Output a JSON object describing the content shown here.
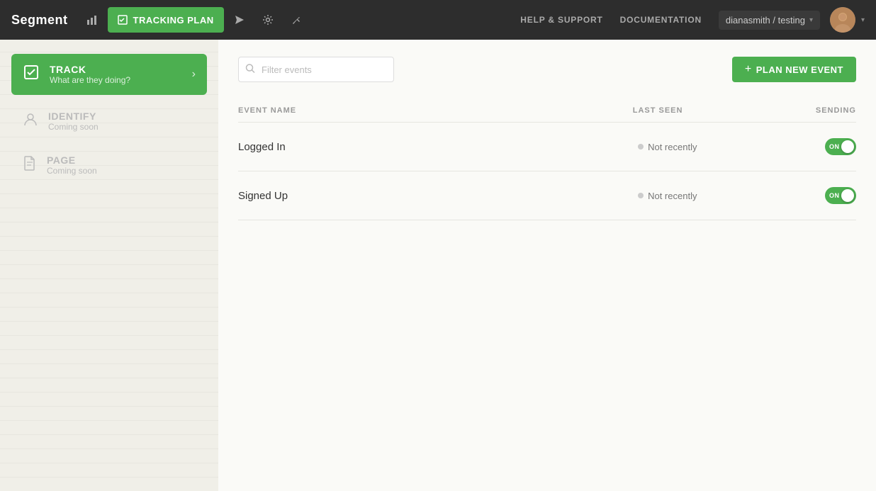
{
  "brand": "Segment",
  "topnav": {
    "active_section": "TRACKING PLAN",
    "links": [
      "HELP & SUPPORT",
      "DOCUMENTATION"
    ],
    "workspace": "dianasmith / testing",
    "icons": {
      "chart": "📊",
      "tracking": "📋",
      "bars": "▐",
      "send": "◀",
      "gear": "⚙",
      "tool": "⚒"
    }
  },
  "sidebar": {
    "items": [
      {
        "id": "track",
        "title": "TRACK",
        "subtitle": "What are they doing?",
        "active": true
      },
      {
        "id": "identify",
        "title": "IDENTIFY",
        "subtitle": "Coming soon",
        "active": false
      },
      {
        "id": "page",
        "title": "PAGE",
        "subtitle": "Coming soon",
        "active": false
      }
    ]
  },
  "main": {
    "filter_placeholder": "Filter events",
    "plan_button_label": "PLAN NEW EVENT",
    "table": {
      "columns": [
        {
          "id": "event_name",
          "label": "EVENT NAME"
        },
        {
          "id": "last_seen",
          "label": "LAST SEEN"
        },
        {
          "id": "sending",
          "label": "SENDING"
        }
      ],
      "rows": [
        {
          "name": "Logged In",
          "last_seen": "Not recently",
          "sending": true,
          "toggle_label": "ON"
        },
        {
          "name": "Signed Up",
          "last_seen": "Not recently",
          "sending": true,
          "toggle_label": "ON"
        }
      ]
    }
  },
  "colors": {
    "green": "#4caf50",
    "dark_nav": "#2d2d2d",
    "sidebar_bg": "#f0efe8",
    "main_bg": "#fafaf7"
  }
}
